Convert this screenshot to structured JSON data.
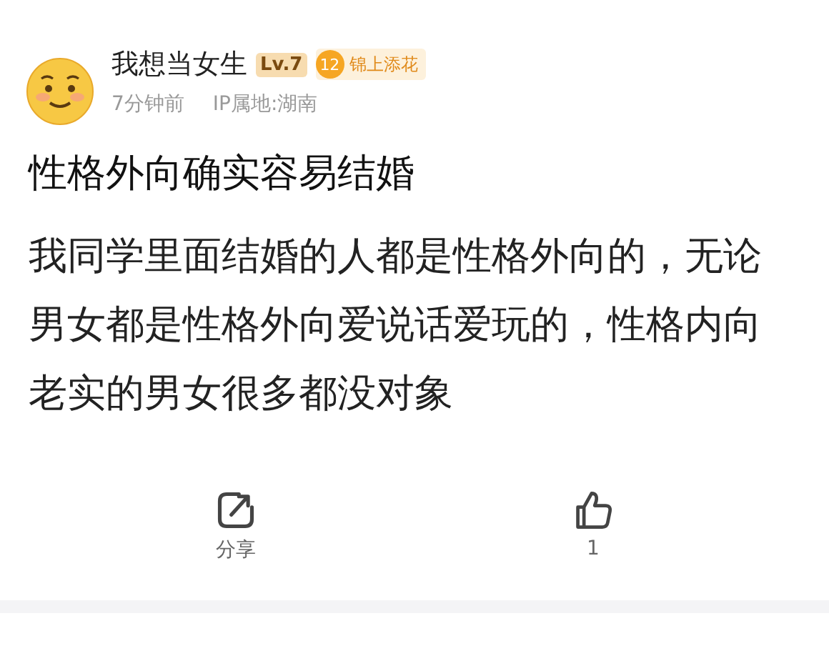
{
  "author": {
    "name": "我想当女生",
    "level": "Lv.7",
    "badge_number": "12",
    "badge_title": "锦上添花",
    "time": "7分钟前",
    "ip": "IP属地:湖南"
  },
  "post": {
    "title": "性格外向确实容易结婚",
    "body": "我同学里面结婚的人都是性格外向的，无论男女都是性格外向爱说话爱玩的，性格内向老实的男女很多都没对象"
  },
  "actions": [
    {
      "kind": "share",
      "label": "分享"
    },
    {
      "kind": "like",
      "label": "1"
    }
  ]
}
